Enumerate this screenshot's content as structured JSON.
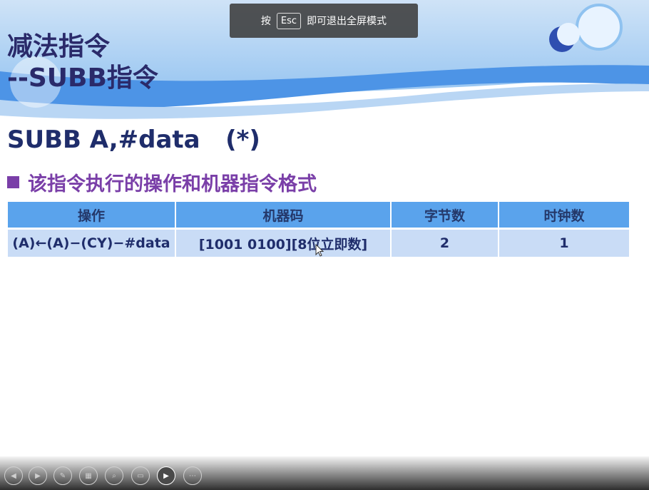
{
  "fullscreen_hint": {
    "prefix": "按",
    "key": "Esc",
    "suffix": "即可退出全屏模式"
  },
  "slide": {
    "title_line1": "减法指令",
    "title_line2": "--SUBB指令",
    "instruction": "SUBB A,#data   (*)",
    "bullet": "该指令执行的操作和机器指令格式",
    "table": {
      "headers": [
        "操作",
        "机器码",
        "字节数",
        "时钟数"
      ],
      "rows": [
        [
          "(A)←(A)−(CY)−#data",
          "[1001 0100][8位立即数]",
          "2",
          "1"
        ]
      ]
    }
  },
  "toolbar": {
    "buttons": [
      {
        "name": "previous-icon",
        "glyph": "◀"
      },
      {
        "name": "next-icon",
        "glyph": "▶"
      },
      {
        "name": "pen-icon",
        "glyph": "✎"
      },
      {
        "name": "slides-icon",
        "glyph": "▦"
      },
      {
        "name": "zoom-icon",
        "glyph": "⌕"
      },
      {
        "name": "subtitles-icon",
        "glyph": "▭"
      },
      {
        "name": "camera-icon",
        "glyph": "▶"
      },
      {
        "name": "more-icon",
        "glyph": "⋯"
      }
    ]
  },
  "colors": {
    "title": "#2a2a6a",
    "accent": "#7a3fa8",
    "header_fill": "#5aa3ec",
    "cell_fill": "#c9dcf6"
  }
}
